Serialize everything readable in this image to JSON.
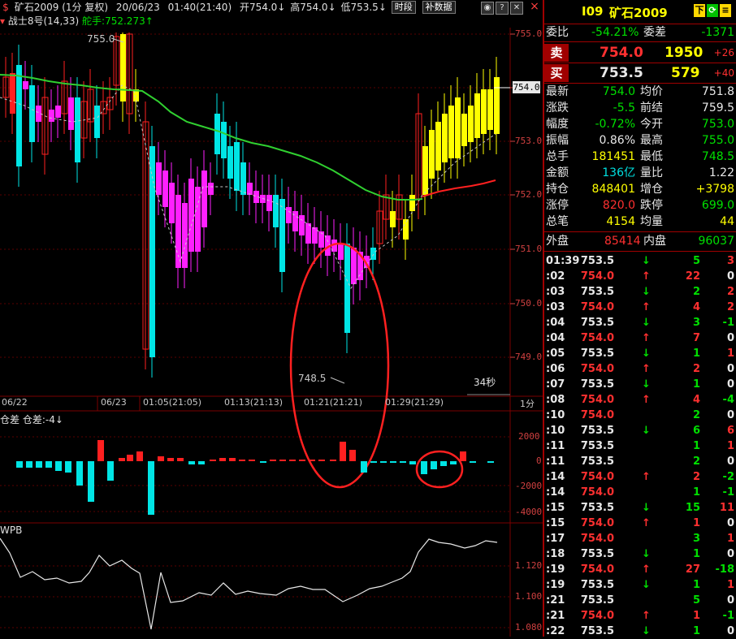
{
  "header": {
    "symbol_name": "矿石2009",
    "period": "(1分 复权)",
    "date": "20/06/23",
    "time": "01:40(21:40)",
    "open": "开754.0",
    "high": "高754.0",
    "low": "低753.5",
    "btn_time": "时段",
    "btn_supplement": "补数据"
  },
  "indicator_line": {
    "name": "战士8号(14,33)",
    "rudder": "舵手:752.273"
  },
  "main_chart": {
    "price_labels": [
      "755.0",
      "754.0",
      "753.0",
      "752.0",
      "751.0",
      "750.0",
      "749.0"
    ],
    "current_price": "754.0",
    "high_mark": "755.0",
    "low_mark": "748.5",
    "countdown": "34秒",
    "time_labels": [
      "06/22",
      "06/23",
      "01:05(21:05)",
      "01:13(21:13)",
      "01:21(21:21)",
      "01:29(21:29)"
    ],
    "period_label": "1分"
  },
  "sub1": {
    "title": "仓差",
    "value": "仓差:-4",
    "ticks": [
      "2000",
      "0",
      "-2000",
      "-4000"
    ]
  },
  "sub2": {
    "title": "WPB",
    "ticks": [
      "1.120",
      "1.100",
      "1.080"
    ]
  },
  "quote": {
    "code": "I09",
    "name": "矿石2009",
    "btn_down": "下",
    "wei_bi_label": "委比",
    "wei_bi": "-54.21%",
    "wei_cha_label": "委差",
    "wei_cha": "-1371",
    "sell_label": "卖",
    "sell_price": "754.0",
    "sell_vol": "1950",
    "sell_chg": "+26",
    "buy_label": "买",
    "buy_price": "753.5",
    "buy_vol": "579",
    "buy_chg": "+40",
    "stats": [
      {
        "l1": "最新",
        "v1": "754.0",
        "c1": "green",
        "l2": "均价",
        "v2": "751.8",
        "c2": "white"
      },
      {
        "l1": "涨跌",
        "v1": "-5.5",
        "c1": "green",
        "l2": "前结",
        "v2": "759.5",
        "c2": "white"
      },
      {
        "l1": "幅度",
        "v1": "-0.72%",
        "c1": "green",
        "l2": "今开",
        "v2": "753.0",
        "c2": "green"
      },
      {
        "l1": "振幅",
        "v1": "0.86%",
        "c1": "white",
        "l2": "最高",
        "v2": "755.0",
        "c2": "green"
      },
      {
        "l1": "总手",
        "v1": "181451",
        "c1": "yellow",
        "l2": "最低",
        "v2": "748.5",
        "c2": "green"
      },
      {
        "l1": "金额",
        "v1": "136亿",
        "c1": "cyan",
        "l2": "量比",
        "v2": "1.22",
        "c2": "white"
      },
      {
        "l1": "持仓",
        "v1": "848401",
        "c1": "yellow",
        "l2": "增仓",
        "v2": "+3798",
        "c2": "yellow"
      },
      {
        "l1": "涨停",
        "v1": "820.0",
        "c1": "red",
        "l2": "跌停",
        "v2": "699.0",
        "c2": "green"
      },
      {
        "l1": "总笔",
        "v1": "4154",
        "c1": "yellow",
        "l2": "均量",
        "v2": "44",
        "c2": "yellow"
      }
    ],
    "outer_label": "外盘",
    "outer": "85414",
    "inner_label": "内盘",
    "inner": "96037"
  },
  "ticks": [
    {
      "t": "01:39",
      "p": "753.5",
      "d": "down",
      "v": "5",
      "c": "3"
    },
    {
      "t": ":02",
      "p": "754.0",
      "d": "up",
      "v": "22",
      "c": "0"
    },
    {
      "t": ":03",
      "p": "753.5",
      "d": "down",
      "v": "2",
      "c": "2"
    },
    {
      "t": ":03",
      "p": "754.0",
      "d": "up",
      "v": "4",
      "c": "2"
    },
    {
      "t": ":04",
      "p": "753.5",
      "d": "down",
      "v": "3",
      "c": "-1"
    },
    {
      "t": ":04",
      "p": "754.0",
      "d": "up",
      "v": "7",
      "c": "0"
    },
    {
      "t": ":05",
      "p": "753.5",
      "d": "down",
      "v": "1",
      "c": "1"
    },
    {
      "t": ":06",
      "p": "754.0",
      "d": "up",
      "v": "2",
      "c": "0"
    },
    {
      "t": ":07",
      "p": "753.5",
      "d": "down",
      "v": "1",
      "c": "0"
    },
    {
      "t": ":08",
      "p": "754.0",
      "d": "up",
      "v": "4",
      "c": "-4"
    },
    {
      "t": ":10",
      "p": "754.0",
      "d": "",
      "v": "2",
      "c": "0"
    },
    {
      "t": ":10",
      "p": "753.5",
      "d": "down",
      "v": "6",
      "c": "6"
    },
    {
      "t": ":11",
      "p": "753.5",
      "d": "",
      "v": "1",
      "c": "1"
    },
    {
      "t": ":11",
      "p": "753.5",
      "d": "",
      "v": "2",
      "c": "0"
    },
    {
      "t": ":14",
      "p": "754.0",
      "d": "up",
      "v": "2",
      "c": "-2"
    },
    {
      "t": ":14",
      "p": "754.0",
      "d": "",
      "v": "1",
      "c": "-1"
    },
    {
      "t": ":15",
      "p": "753.5",
      "d": "down",
      "v": "15",
      "c": "11"
    },
    {
      "t": ":15",
      "p": "754.0",
      "d": "up",
      "v": "1",
      "c": "0"
    },
    {
      "t": ":17",
      "p": "754.0",
      "d": "",
      "v": "3",
      "c": "1"
    },
    {
      "t": ":18",
      "p": "753.5",
      "d": "down",
      "v": "1",
      "c": "0"
    },
    {
      "t": ":19",
      "p": "754.0",
      "d": "up",
      "v": "27",
      "c": "-18"
    },
    {
      "t": ":19",
      "p": "753.5",
      "d": "down",
      "v": "1",
      "c": "1"
    },
    {
      "t": ":21",
      "p": "753.5",
      "d": "",
      "v": "5",
      "c": "0"
    },
    {
      "t": ":21",
      "p": "754.0",
      "d": "up",
      "v": "1",
      "c": "-1"
    },
    {
      "t": ":22",
      "p": "753.5",
      "d": "down",
      "v": "1",
      "c": "0"
    }
  ],
  "colors": {
    "up": "#ff3030",
    "down": "#00e000",
    "accent_red": "#a00000"
  }
}
